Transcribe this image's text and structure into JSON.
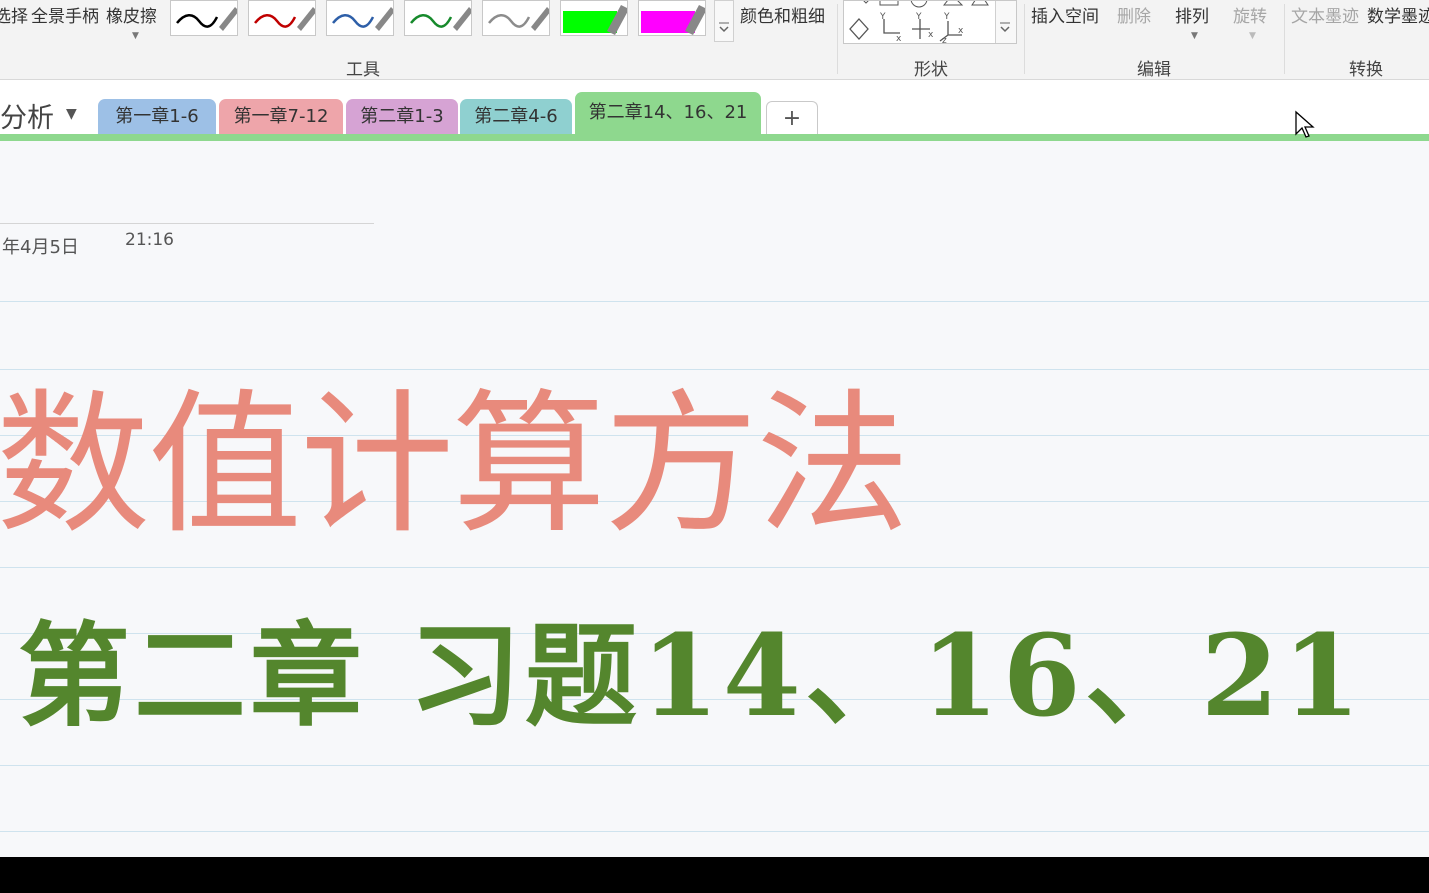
{
  "ribbon": {
    "select_label": "选择",
    "fullscreen_handle_label": "全景手柄",
    "eraser_label": "橡皮擦",
    "color_thickness_label": "颜色和粗细",
    "insert_space_label": "插入空间",
    "delete_label": "删除",
    "arrange_label": "排列",
    "rotate_label": "旋转",
    "ink_to_text_label": "文本墨迹",
    "ink_to_math_label": "数学墨迹",
    "groups": {
      "tools": "工具",
      "shapes": "形状",
      "edit": "编辑",
      "convert": "转换"
    },
    "pens": [
      {
        "color": "#000000",
        "kind": "pen"
      },
      {
        "color": "#c00000",
        "kind": "pen"
      },
      {
        "color": "#2e5fa8",
        "kind": "pen"
      },
      {
        "color": "#178a2c",
        "kind": "pen"
      },
      {
        "color": "#8c8c8c",
        "kind": "pen"
      },
      {
        "color": "#00ff00",
        "kind": "highlighter"
      },
      {
        "color": "#ff00ff",
        "kind": "highlighter"
      }
    ]
  },
  "notebook": {
    "name": "分析"
  },
  "tabs": [
    {
      "label": "第一章1-6",
      "color": "#9dc0e6"
    },
    {
      "label": "第一章7-12",
      "color": "#eea5aa"
    },
    {
      "label": "第二章1-3",
      "color": "#d6a3d4"
    },
    {
      "label": "第二章4-6",
      "color": "#8fd0d0"
    },
    {
      "label": "第二章14、16、21",
      "color": "#8ed88e",
      "active": true
    }
  ],
  "tab_add_label": "+",
  "page": {
    "date": "年4月5日",
    "time": "21:16",
    "title_line": "数值计算方法",
    "subtitle_line": "第二章 习题14、16、21"
  },
  "colors": {
    "title": "#e88a7c",
    "subtitle": "#54862d",
    "active_section": "#8ed88e"
  }
}
